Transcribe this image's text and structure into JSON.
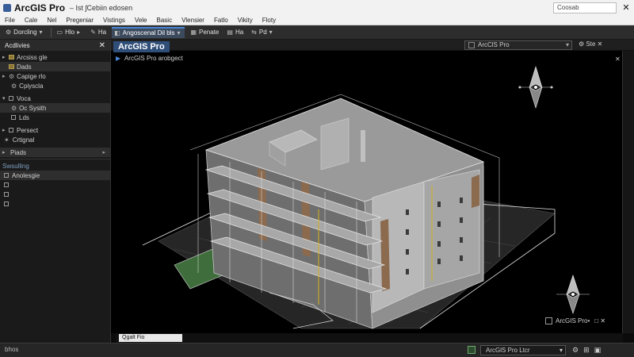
{
  "titlebar": {
    "app_name": "ArcGIS Pro",
    "doc_name": "–  Ist ʃCebiin edosen",
    "search_value": "Coosab",
    "close_glyph": "✕"
  },
  "menu": [
    "File",
    "Cale",
    "Nel",
    "Pregeniar",
    "Vistings",
    "Vele",
    "Basic",
    "Vlensier",
    "Fatlo",
    "Vikity",
    "Floty"
  ],
  "toolbar": {
    "items": [
      {
        "glyph": "⚙",
        "label": "Dorcling",
        "chev": "▾"
      },
      {
        "glyph": "▭",
        "label": "Hlo",
        "chev": "▸"
      },
      {
        "glyph": "",
        "label": "Ha",
        "chev": ""
      },
      {
        "glyph": "",
        "label": "Angoscenal Dil bls",
        "chev": "▾",
        "active": true
      },
      {
        "glyph": "",
        "label": "Penate",
        "chev": ""
      },
      {
        "glyph": "",
        "label": "Ha",
        "chev": ""
      },
      {
        "glyph": "",
        "label": "Pd",
        "chev": "▾"
      }
    ]
  },
  "subbar": {
    "dropdown_value": "ArcClS Pro",
    "right_tools": "⚙ Ste ✕"
  },
  "left_panel": {
    "title": "Acdlivies",
    "close_glyph": "✕",
    "tree": [
      {
        "mark": "▸",
        "icon": "folder",
        "label": "Arcsiss gle",
        "selected": false
      },
      {
        "mark": "",
        "icon": "folder",
        "label": "Dads",
        "selected": true
      },
      {
        "mark": "▸",
        "icon": "gear",
        "label": "Capige rlo",
        "selected": false
      },
      {
        "mark": "",
        "icon": "gear",
        "label": "Cpiyscla",
        "selected": false
      },
      {
        "mark": "▾",
        "icon": "box",
        "label": "Voca",
        "selected": false
      },
      {
        "mark": "",
        "icon": "gear",
        "label": "Oc Sysith",
        "selected": false
      },
      {
        "mark": "",
        "icon": "box",
        "label": "Lds",
        "selected": false
      },
      {
        "mark": "▸",
        "icon": "box",
        "label": "Persect",
        "selected": false
      },
      {
        "mark": "",
        "icon": "",
        "label": "Crtignal",
        "selected": false
      },
      {
        "mark": "▸",
        "icon": "",
        "label": "Piads",
        "selected": false
      },
      {
        "mark": "",
        "icon": "",
        "label": "Swsulling",
        "selected": false
      },
      {
        "mark": "",
        "icon": "box",
        "label": "Anolesgie",
        "selected": true
      }
    ]
  },
  "map": {
    "title_badge": "ArcGIS Pro",
    "document_label": "ArcGIS Pro arobgect",
    "close_glyph": "✕",
    "status_label": "ArcGIS Pro•",
    "status_close": "□ ✕",
    "coord_value": "Qgalt Fio",
    "colors": {
      "building": "#8f8f8f",
      "facade_brown": "#8b6a4e",
      "railing": "#e6e6e6",
      "ground": "#2a2a2a",
      "grass": "#3f6e3c",
      "accent_yellow": "#d4b21a"
    }
  },
  "statusbar": {
    "left_text": "bhos",
    "dropdown_value": "ArcGlS Pro Ltcr",
    "chev": "▾",
    "tools": "⚙⊞▣"
  }
}
